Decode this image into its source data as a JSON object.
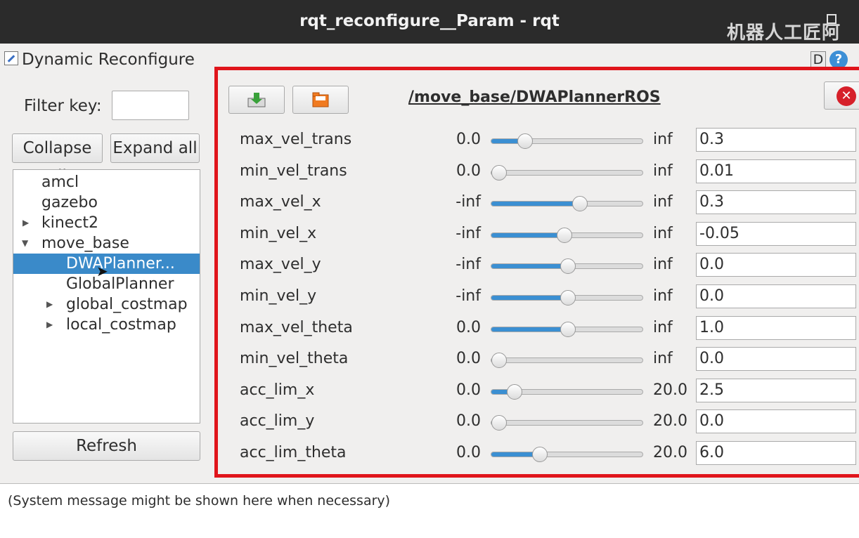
{
  "window": {
    "title": "rqt_reconfigure__Param - rqt"
  },
  "watermark": "机器人工匠阿",
  "plugin": {
    "title": "Dynamic Reconfigure",
    "help_d": "D",
    "help_q": "?"
  },
  "filter": {
    "label": "Filter key:",
    "value": ""
  },
  "buttons": {
    "collapse_all": "Collapse all",
    "expand_all": "Expand all",
    "refresh": "Refresh"
  },
  "tree": {
    "items": [
      {
        "label": "amcl"
      },
      {
        "label": "gazebo"
      },
      {
        "label": "kinect2"
      },
      {
        "label": "move_base"
      },
      {
        "label": "DWAPlanner..."
      },
      {
        "label": "GlobalPlanner"
      },
      {
        "label": "global_costmap"
      },
      {
        "label": "local_costmap"
      }
    ]
  },
  "node": {
    "name": "/move_base/DWAPlannerROS"
  },
  "params": [
    {
      "name": "max_vel_trans",
      "min": "0.0",
      "max": "inf",
      "value": "0.3",
      "level": 0.22
    },
    {
      "name": "min_vel_trans",
      "min": "0.0",
      "max": "inf",
      "value": "0.01",
      "level": 0.05
    },
    {
      "name": "max_vel_x",
      "min": "-inf",
      "max": "inf",
      "value": "0.3",
      "level": 0.58
    },
    {
      "name": "min_vel_x",
      "min": "-inf",
      "max": "inf",
      "value": "-0.05",
      "level": 0.48
    },
    {
      "name": "max_vel_y",
      "min": "-inf",
      "max": "inf",
      "value": "0.0",
      "level": 0.5
    },
    {
      "name": "min_vel_y",
      "min": "-inf",
      "max": "inf",
      "value": "0.0",
      "level": 0.5
    },
    {
      "name": "max_vel_theta",
      "min": "0.0",
      "max": "inf",
      "value": "1.0",
      "level": 0.5
    },
    {
      "name": "min_vel_theta",
      "min": "0.0",
      "max": "inf",
      "value": "0.0",
      "level": 0.05
    },
    {
      "name": "acc_lim_x",
      "min": "0.0",
      "max": "20.0",
      "value": "2.5",
      "level": 0.15
    },
    {
      "name": "acc_lim_y",
      "min": "0.0",
      "max": "20.0",
      "value": "0.0",
      "level": 0.05
    },
    {
      "name": "acc_lim_theta",
      "min": "0.0",
      "max": "20.0",
      "value": "6.0",
      "level": 0.32
    }
  ],
  "status": {
    "message": "(System message might be shown here when necessary)"
  },
  "colors": {
    "accent": "#3b8fd2",
    "highlight_border": "#e0141b",
    "selection": "#3a8ac9"
  }
}
